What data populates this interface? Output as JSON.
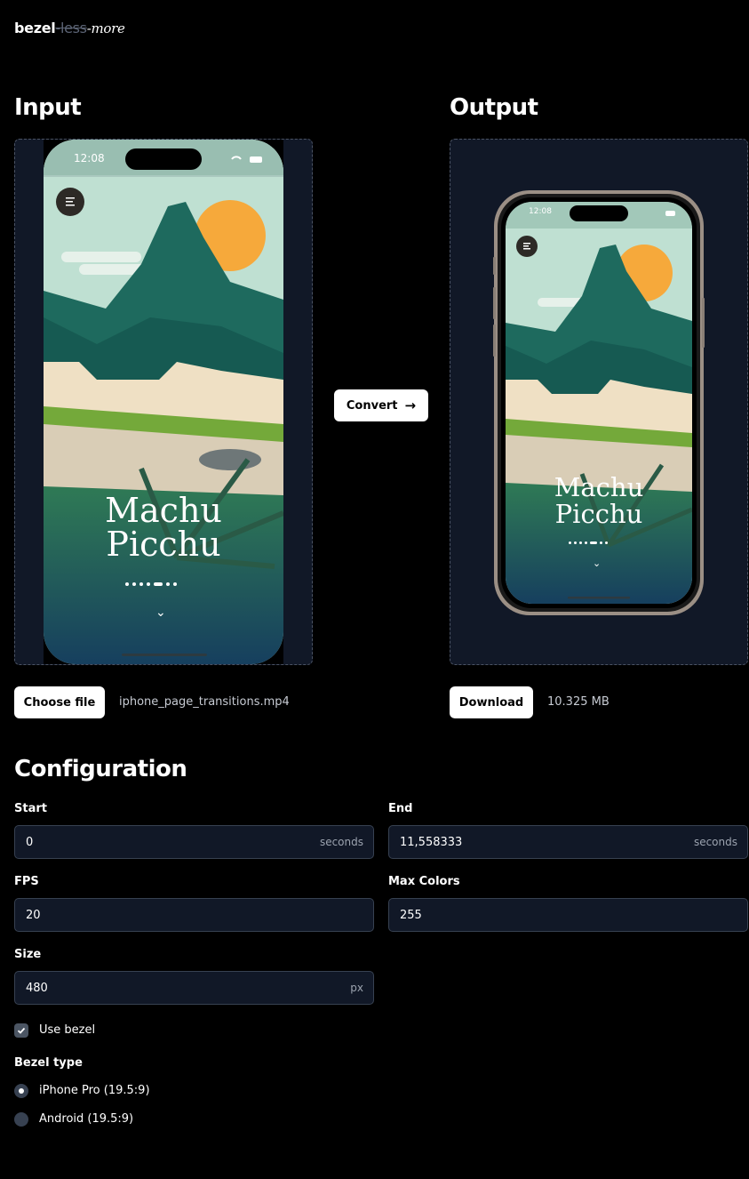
{
  "logo": {
    "part1": "bezel",
    "part2": "-less",
    "part3": "-more"
  },
  "input": {
    "heading": "Input",
    "filename": "iphone_page_transitions.mp4",
    "choose_label": "Choose file"
  },
  "output": {
    "heading": "Output",
    "filesize": "10.325 MB",
    "download_label": "Download"
  },
  "convert": {
    "label": "Convert"
  },
  "phone": {
    "time": "12:08",
    "title_line1": "Machu",
    "title_line2": "Picchu"
  },
  "config": {
    "heading": "Configuration",
    "start": {
      "label": "Start",
      "value": "0",
      "suffix": "seconds"
    },
    "end": {
      "label": "End",
      "value": "11,558333",
      "suffix": "seconds"
    },
    "fps": {
      "label": "FPS",
      "value": "20"
    },
    "max_colors": {
      "label": "Max Colors",
      "value": "255"
    },
    "size": {
      "label": "Size",
      "value": "480",
      "suffix": "px"
    },
    "use_bezel": {
      "label": "Use bezel",
      "checked": true
    },
    "bezel_type": {
      "label": "Bezel type",
      "options": [
        "iPhone Pro (19.5:9)",
        "Android (19.5:9)"
      ],
      "selected": "iPhone Pro (19.5:9)"
    }
  },
  "colors": {
    "page_bg": "#000000",
    "panel_bg": "#111827",
    "field_bg": "#111827",
    "sky": "#bfe0d2",
    "mountain": "#1e6a5e",
    "sun": "#f6a93b",
    "grass": "#74a93a"
  }
}
